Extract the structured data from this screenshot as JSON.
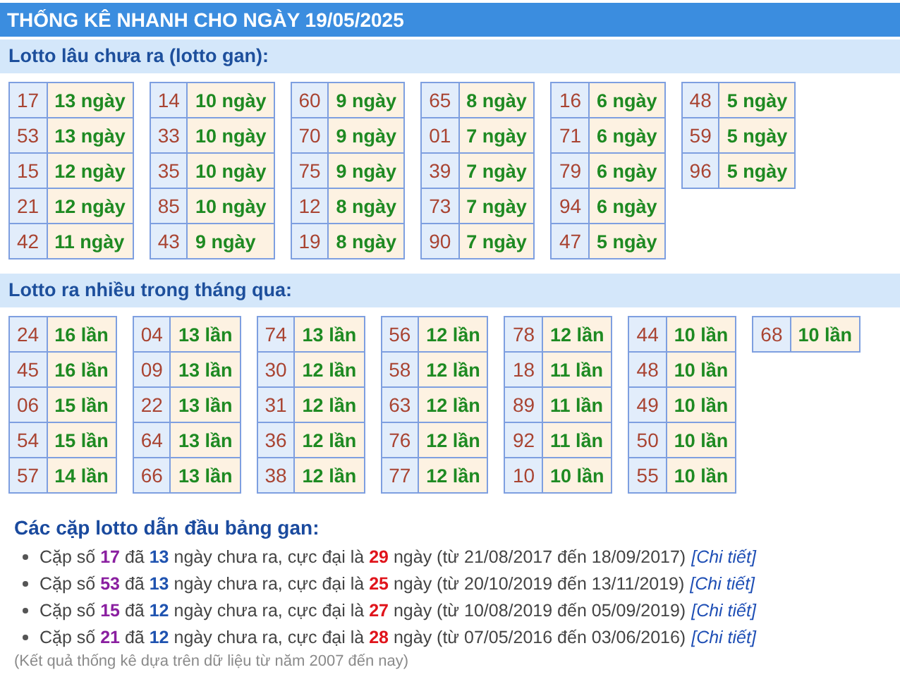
{
  "header": {
    "title": "THỐNG KÊ NHANH CHO NGÀY 19/05/2025"
  },
  "sections": [
    {
      "title": "Lotto lâu chưa ra (lotto gan):",
      "groups": [
        [
          {
            "number": "17",
            "value": "13 ngày"
          },
          {
            "number": "53",
            "value": "13 ngày"
          },
          {
            "number": "15",
            "value": "12 ngày"
          },
          {
            "number": "21",
            "value": "12 ngày"
          },
          {
            "number": "42",
            "value": "11 ngày"
          }
        ],
        [
          {
            "number": "14",
            "value": "10 ngày"
          },
          {
            "number": "33",
            "value": "10 ngày"
          },
          {
            "number": "35",
            "value": "10 ngày"
          },
          {
            "number": "85",
            "value": "10 ngày"
          },
          {
            "number": "43",
            "value": "9 ngày"
          }
        ],
        [
          {
            "number": "60",
            "value": "9 ngày"
          },
          {
            "number": "70",
            "value": "9 ngày"
          },
          {
            "number": "75",
            "value": "9 ngày"
          },
          {
            "number": "12",
            "value": "8 ngày"
          },
          {
            "number": "19",
            "value": "8 ngày"
          }
        ],
        [
          {
            "number": "65",
            "value": "8 ngày"
          },
          {
            "number": "01",
            "value": "7 ngày"
          },
          {
            "number": "39",
            "value": "7 ngày"
          },
          {
            "number": "73",
            "value": "7 ngày"
          },
          {
            "number": "90",
            "value": "7 ngày"
          }
        ],
        [
          {
            "number": "16",
            "value": "6 ngày"
          },
          {
            "number": "71",
            "value": "6 ngày"
          },
          {
            "number": "79",
            "value": "6 ngày"
          },
          {
            "number": "94",
            "value": "6 ngày"
          },
          {
            "number": "47",
            "value": "5 ngày"
          }
        ],
        [
          {
            "number": "48",
            "value": "5 ngày"
          },
          {
            "number": "59",
            "value": "5 ngày"
          },
          {
            "number": "96",
            "value": "5 ngày"
          }
        ]
      ]
    },
    {
      "title": "Lotto ra nhiều trong tháng qua:",
      "groups": [
        [
          {
            "number": "24",
            "value": "16 lần"
          },
          {
            "number": "45",
            "value": "16 lần"
          },
          {
            "number": "06",
            "value": "15 lần"
          },
          {
            "number": "54",
            "value": "15 lần"
          },
          {
            "number": "57",
            "value": "14 lần"
          }
        ],
        [
          {
            "number": "04",
            "value": "13 lần"
          },
          {
            "number": "09",
            "value": "13 lần"
          },
          {
            "number": "22",
            "value": "13 lần"
          },
          {
            "number": "64",
            "value": "13 lần"
          },
          {
            "number": "66",
            "value": "13 lần"
          }
        ],
        [
          {
            "number": "74",
            "value": "13 lần"
          },
          {
            "number": "30",
            "value": "12 lần"
          },
          {
            "number": "31",
            "value": "12 lần"
          },
          {
            "number": "36",
            "value": "12 lần"
          },
          {
            "number": "38",
            "value": "12 lần"
          }
        ],
        [
          {
            "number": "56",
            "value": "12 lần"
          },
          {
            "number": "58",
            "value": "12 lần"
          },
          {
            "number": "63",
            "value": "12 lần"
          },
          {
            "number": "76",
            "value": "12 lần"
          },
          {
            "number": "77",
            "value": "12 lần"
          }
        ],
        [
          {
            "number": "78",
            "value": "12 lần"
          },
          {
            "number": "18",
            "value": "11 lần"
          },
          {
            "number": "89",
            "value": "11 lần"
          },
          {
            "number": "92",
            "value": "11 lần"
          },
          {
            "number": "10",
            "value": "10 lần"
          }
        ],
        [
          {
            "number": "44",
            "value": "10 lần"
          },
          {
            "number": "48",
            "value": "10 lần"
          },
          {
            "number": "49",
            "value": "10 lần"
          },
          {
            "number": "50",
            "value": "10 lần"
          },
          {
            "number": "55",
            "value": "10 lần"
          }
        ],
        [
          {
            "number": "68",
            "value": "10 lần"
          }
        ]
      ]
    }
  ],
  "summary": {
    "title": "Các cặp lotto dẫn đầu bảng gan:",
    "items": [
      {
        "prefix": "Cặp số",
        "pair": "17",
        "mid": "đã",
        "days": "13",
        "text": "ngày chưa ra, cực đại là",
        "max": "29",
        "unit": "ngày",
        "range": "(từ 21/08/2017 đến 18/09/2017)",
        "link": "[Chi tiết]"
      },
      {
        "prefix": "Cặp số",
        "pair": "53",
        "mid": "đã",
        "days": "13",
        "text": "ngày chưa ra, cực đại là",
        "max": "25",
        "unit": "ngày",
        "range": "(từ 20/10/2019 đến 13/11/2019)",
        "link": "[Chi tiết]"
      },
      {
        "prefix": "Cặp số",
        "pair": "15",
        "mid": "đã",
        "days": "12",
        "text": "ngày chưa ra, cực đại là",
        "max": "27",
        "unit": "ngày",
        "range": "(từ 10/08/2019 đến 05/09/2019)",
        "link": "[Chi tiết]"
      },
      {
        "prefix": "Cặp số",
        "pair": "21",
        "mid": "đã",
        "days": "12",
        "text": "ngày chưa ra, cực đại là",
        "max": "28",
        "unit": "ngày",
        "range": "(từ 07/05/2016 đến 03/06/2016)",
        "link": "[Chi tiết]"
      }
    ],
    "note": "(Kết quả thống kê dựa trên dữ liệu từ năm 2007 đến nay)"
  }
}
